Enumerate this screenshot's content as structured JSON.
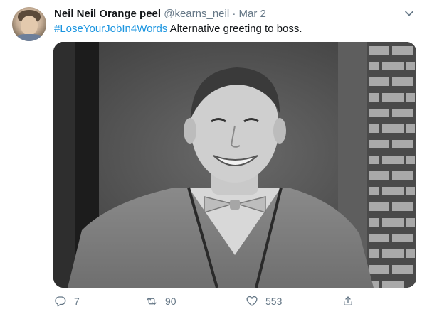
{
  "tweet": {
    "author_name": "Neil Neil Orange peel",
    "author_handle": "@kearns_neil",
    "separator": "·",
    "date": "Mar 2",
    "hashtag": "#LoseYourJobIn4Words",
    "text": " Alternative greeting to boss.",
    "media_icon": "photo-placeholder"
  },
  "actions": {
    "reply_count": "7",
    "retweet_count": "90",
    "like_count": "553"
  },
  "colors": {
    "link": "#1b95e0",
    "secondary_text": "#657786",
    "primary_text": "#14171a"
  }
}
